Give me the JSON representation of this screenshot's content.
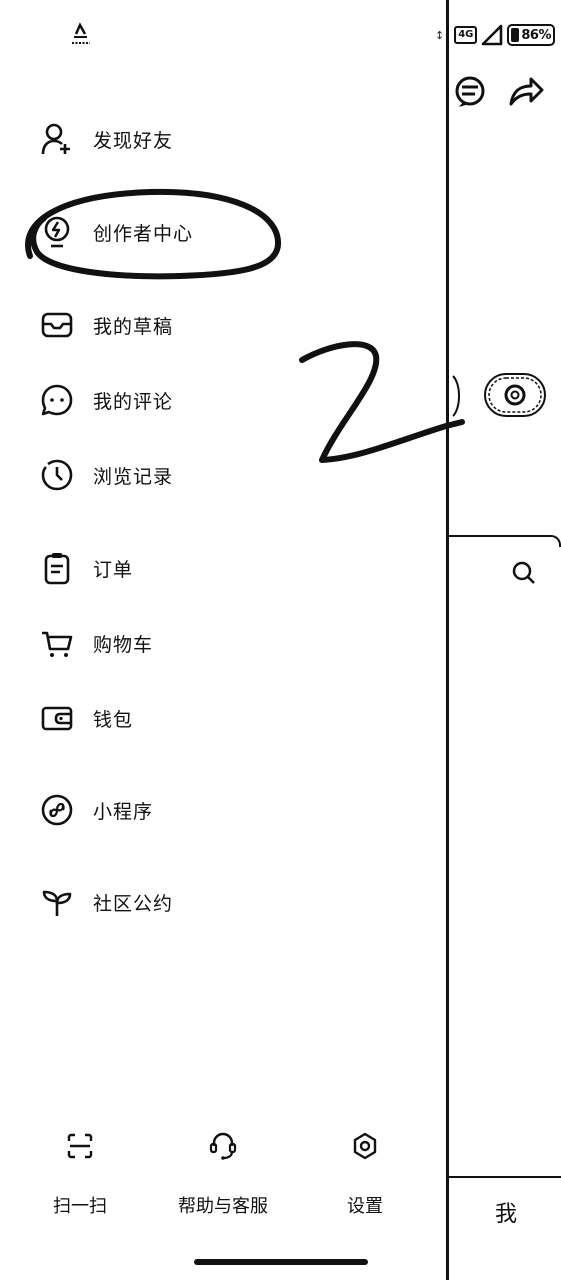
{
  "status_bar": {
    "network": "4G",
    "battery": "86%",
    "battery_level_percent": 86
  },
  "drawer": {
    "menu": [
      {
        "label": "发现好友",
        "icon": "add-friend-icon"
      },
      {
        "label": "创作者中心",
        "icon": "lightbulb-bolt-icon"
      },
      {
        "label": "我的草稿",
        "icon": "drafts-box-icon"
      },
      {
        "label": "我的评论",
        "icon": "comment-bubble-icon"
      },
      {
        "label": "浏览记录",
        "icon": "clock-icon"
      },
      {
        "label": "订单",
        "icon": "clipboard-icon"
      },
      {
        "label": "购物车",
        "icon": "cart-icon"
      },
      {
        "label": "钱包",
        "icon": "wallet-icon"
      },
      {
        "label": "小程序",
        "icon": "mini-program-icon"
      },
      {
        "label": "社区公约",
        "icon": "sprout-icon"
      }
    ],
    "bottom_actions": [
      {
        "label": "扫一扫",
        "icon": "scan-icon"
      },
      {
        "label": "帮助与客服",
        "icon": "headset-icon"
      },
      {
        "label": "设置",
        "icon": "settings-icon"
      }
    ]
  },
  "background_page": {
    "tab_me": "我",
    "icons": [
      "chat-icon",
      "share-icon",
      "settings-icon",
      "search-icon"
    ]
  },
  "annotations": {
    "handwritten_text": "2",
    "circled_item": "创作者中心"
  }
}
